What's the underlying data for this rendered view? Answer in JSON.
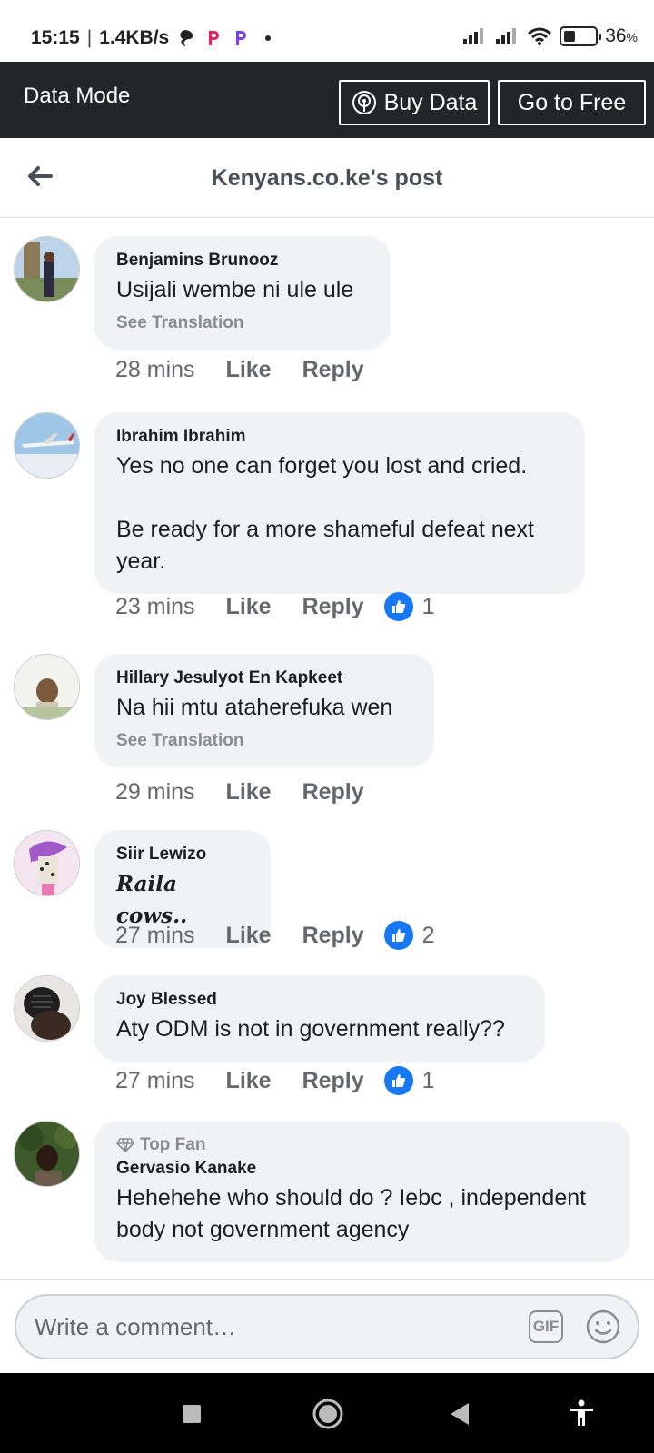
{
  "status_bar": {
    "time": "15:15",
    "separator": "|",
    "speed": "1.4KB/s",
    "battery": "36",
    "battery_unit": "%",
    "battery_level": 0.36
  },
  "data_mode": {
    "title": "Data Mode",
    "buy_label": "Buy Data",
    "free_label": "Go to Free"
  },
  "header": {
    "title": "Kenyans.co.ke's post"
  },
  "comments": [
    {
      "author": "Benjamins Brunooz",
      "text": "Usijali wembe ni ule ule",
      "see_translation": "See Translation",
      "time": "28 mins",
      "like_label": "Like",
      "reply_label": "Reply"
    },
    {
      "author": "Ibrahim Ibrahim",
      "text": "Yes no one can forget you lost and cried.\n\nBe ready for a more shameful defeat next year.",
      "time": "23 mins",
      "like_label": "Like",
      "reply_label": "Reply",
      "reactions": "1"
    },
    {
      "author": "Hillary Jesulyot En Kapkeet",
      "text": "Na hii mtu ataherefuka wen",
      "see_translation": "See Translation",
      "time": "29 mins",
      "like_label": "Like",
      "reply_label": "Reply"
    },
    {
      "author": "Siir Lewizo",
      "text": "Raila cows..",
      "time": "27 mins",
      "like_label": "Like",
      "reply_label": "Reply",
      "reactions": "2"
    },
    {
      "author": "Joy Blessed",
      "text": "Aty ODM is not in government really??",
      "time": "27 mins",
      "like_label": "Like",
      "reply_label": "Reply",
      "reactions": "1"
    },
    {
      "badge": "Top Fan",
      "author": "Gervasio Kanake",
      "text": "Hehehehe who should do ? Iebc , independent body not government agency"
    }
  ],
  "composer": {
    "placeholder": "Write a comment…",
    "gif_label": "GIF"
  },
  "colors": {
    "accent": "#1877f2",
    "bubble": "#f0f2f5",
    "data_bar": "#242526"
  }
}
